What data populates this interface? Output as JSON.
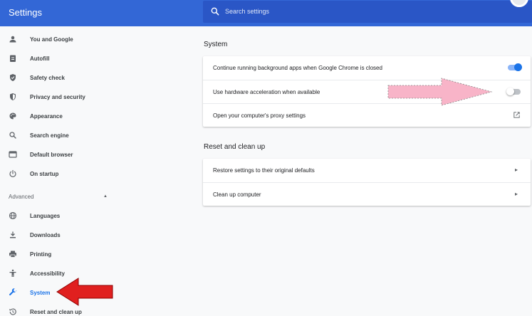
{
  "header": {
    "title": "Settings",
    "search_placeholder": "Search settings"
  },
  "sidebar": {
    "items": [
      {
        "label": "You and Google",
        "icon": "person-icon"
      },
      {
        "label": "Autofill",
        "icon": "clipboard-icon"
      },
      {
        "label": "Safety check",
        "icon": "shield-check-icon"
      },
      {
        "label": "Privacy and security",
        "icon": "shield-icon"
      },
      {
        "label": "Appearance",
        "icon": "palette-icon"
      },
      {
        "label": "Search engine",
        "icon": "search-icon"
      },
      {
        "label": "Default browser",
        "icon": "browser-icon"
      },
      {
        "label": "On startup",
        "icon": "power-icon"
      }
    ],
    "advanced_label": "Advanced",
    "advanced_items": [
      {
        "label": "Languages",
        "icon": "globe-icon"
      },
      {
        "label": "Downloads",
        "icon": "download-icon"
      },
      {
        "label": "Printing",
        "icon": "printer-icon"
      },
      {
        "label": "Accessibility",
        "icon": "accessibility-icon"
      },
      {
        "label": "System",
        "icon": "wrench-icon",
        "active": true
      },
      {
        "label": "Reset and clean up",
        "icon": "history-icon"
      }
    ]
  },
  "system": {
    "title": "System",
    "rows": [
      {
        "label": "Continue running background apps when Google Chrome is closed",
        "control": "toggle",
        "state": "on"
      },
      {
        "label": "Use hardware acceleration when available",
        "control": "toggle",
        "state": "off"
      },
      {
        "label": "Open your computer's proxy settings",
        "control": "external-link-icon"
      }
    ]
  },
  "reset": {
    "title": "Reset and clean up",
    "rows": [
      {
        "label": "Restore settings to their original defaults",
        "control": "chevron-right-icon"
      },
      {
        "label": "Clean up computer",
        "control": "chevron-right-icon"
      }
    ]
  },
  "colors": {
    "header": "#3367d6",
    "accent": "#1a73e8",
    "pink_arrow": "#f8b4c8",
    "red_arrow": "#e0201f"
  }
}
